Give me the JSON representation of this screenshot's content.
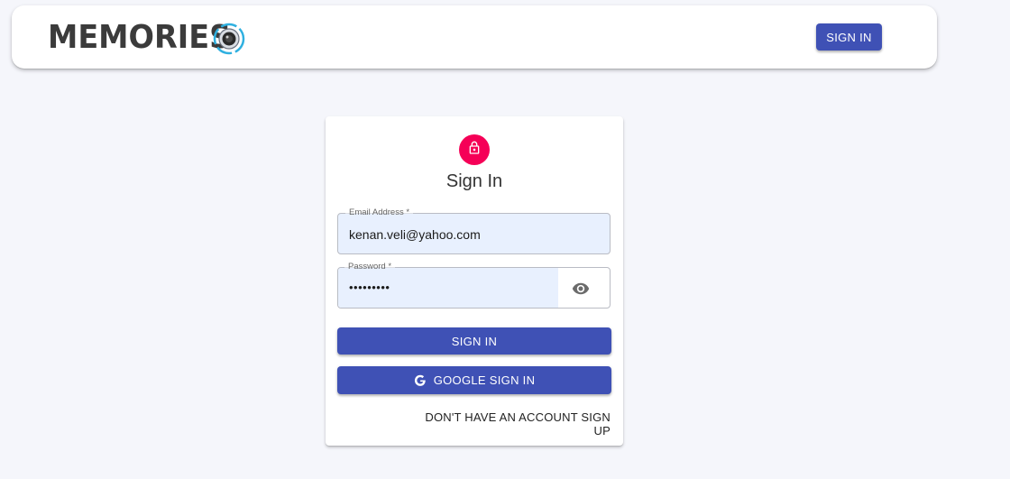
{
  "navbar": {
    "brand_text": "MEMORIES",
    "signin_label": "SIGN IN"
  },
  "auth_card": {
    "title": "Sign In",
    "email": {
      "label": "Email Address *",
      "value": "kenan.veli@yahoo.com"
    },
    "password": {
      "label": "Password *",
      "value": "•••••••••"
    },
    "signin_label": "SIGN IN",
    "google_label": "GOOGLE SIGN IN",
    "switch_label": "DON'T HAVE AN ACCOUNT SIGN UP"
  },
  "icons": {
    "logo": "camera-lens-icon",
    "avatar": "lock-icon",
    "password_toggle": "eye-icon",
    "google": "google-g-icon"
  },
  "colors": {
    "primary": "#3f51b5",
    "avatar": "#f50057",
    "autofill": "#e8f0fe",
    "background": "#f5f6fb",
    "logo_accent": "#2fb0e0"
  }
}
